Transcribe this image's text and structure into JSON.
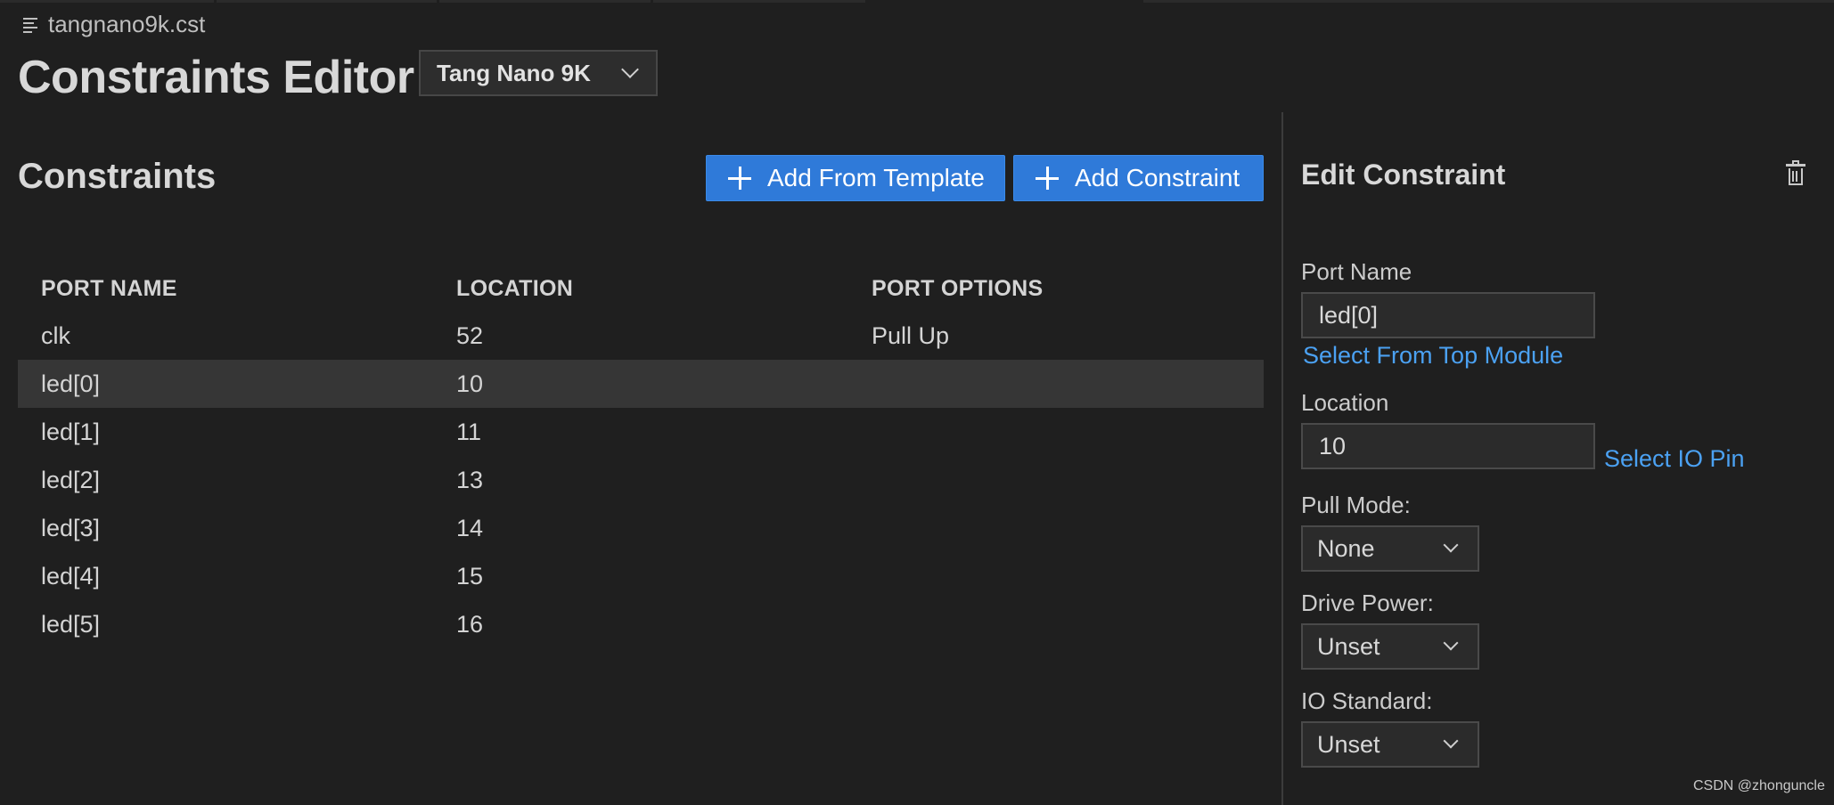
{
  "breadcrumb": {
    "file_name": "tangnano9k.cst"
  },
  "header": {
    "title": "Constraints Editor",
    "board": "Tang Nano 9K"
  },
  "constraints": {
    "title": "Constraints",
    "add_from_template_label": "Add From Template",
    "add_constraint_label": "Add Constraint",
    "columns": [
      "PORT NAME",
      "LOCATION",
      "PORT OPTIONS"
    ],
    "rows": [
      {
        "port": "clk",
        "location": "52",
        "options": "Pull Up"
      },
      {
        "port": "led[0]",
        "location": "10",
        "options": ""
      },
      {
        "port": "led[1]",
        "location": "11",
        "options": ""
      },
      {
        "port": "led[2]",
        "location": "13",
        "options": ""
      },
      {
        "port": "led[3]",
        "location": "14",
        "options": ""
      },
      {
        "port": "led[4]",
        "location": "15",
        "options": ""
      },
      {
        "port": "led[5]",
        "location": "16",
        "options": ""
      }
    ],
    "selected_row": 1
  },
  "edit": {
    "title": "Edit Constraint",
    "port_name_label": "Port Name",
    "port_name_value": "led[0]",
    "select_top_module_link": "Select From Top Module",
    "location_label": "Location",
    "location_value": "10",
    "select_io_pin_link": "Select IO Pin",
    "pull_mode_label": "Pull Mode:",
    "pull_mode_value": "None",
    "drive_power_label": "Drive Power:",
    "drive_power_value": "Unset",
    "io_standard_label": "IO Standard:",
    "io_standard_value": "Unset"
  },
  "watermark": "CSDN @zhonguncle",
  "colors": {
    "accent": "#2f7ad9",
    "link": "#4ba1f2",
    "background": "#1f1f1f",
    "selected_row": "#363636"
  },
  "icons": {
    "breadcrumb": "file-lines-icon",
    "delete": "trash-icon",
    "dropdown": "chevron-down-icon",
    "add": "plus-icon"
  }
}
